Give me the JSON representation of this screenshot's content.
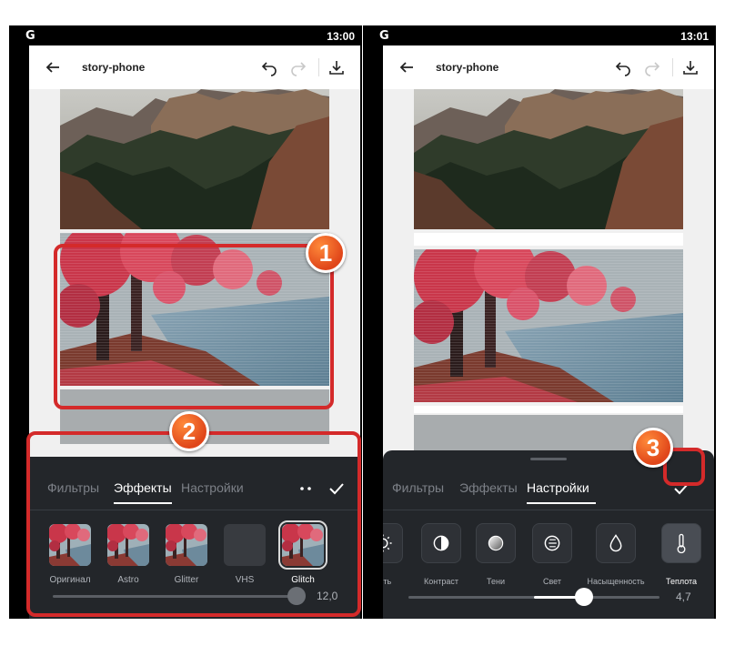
{
  "left": {
    "status": {
      "logo": "G",
      "time": "13:00"
    },
    "header": {
      "title": "story-phone"
    },
    "tabs": [
      {
        "label": "Фильтры",
        "active": false
      },
      {
        "label": "Эффекты",
        "active": true
      },
      {
        "label": "Настройки",
        "active": false
      }
    ],
    "effects": [
      {
        "label": "Оригинал",
        "selected": false
      },
      {
        "label": "Astro",
        "selected": false
      },
      {
        "label": "Glitter",
        "selected": false
      },
      {
        "label": "VHS",
        "selected": false
      },
      {
        "label": "Glitch",
        "selected": true
      }
    ],
    "slider": {
      "value": "12,0",
      "fraction": 1.0
    }
  },
  "right": {
    "status": {
      "logo": "G",
      "time": "13:01"
    },
    "header": {
      "title": "story-phone"
    },
    "tabs": [
      {
        "label": "Фильтры",
        "active": false
      },
      {
        "label": "Эффекты",
        "active": false
      },
      {
        "label": "Настройки",
        "active": true
      }
    ],
    "adjustments": [
      {
        "label": "ость",
        "icon": "brightness-icon",
        "active": false
      },
      {
        "label": "Контраст",
        "icon": "contrast-icon",
        "active": false
      },
      {
        "label": "Тени",
        "icon": "shadows-icon",
        "active": false
      },
      {
        "label": "Свет",
        "icon": "highlights-icon",
        "active": false
      },
      {
        "label": "Насыщенность",
        "icon": "saturation-icon",
        "active": false
      },
      {
        "label": "Теплота",
        "icon": "warmth-icon",
        "active": true
      }
    ],
    "slider": {
      "value": "4,7",
      "fraction": 0.7
    }
  },
  "annotations": [
    {
      "number": "1"
    },
    {
      "number": "2"
    },
    {
      "number": "3"
    }
  ],
  "colors": {
    "highlight": "#d42a2a",
    "badge": "#e0461a",
    "panel": "#23262a"
  }
}
